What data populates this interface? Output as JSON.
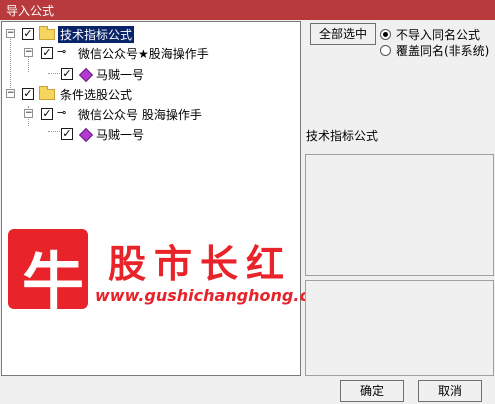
{
  "window": {
    "title": "导入公式"
  },
  "tree": {
    "nodes": [
      {
        "label": "技术指标公式"
      },
      {
        "label": "微信公众号★股海操作手"
      },
      {
        "label": "马贼一号"
      },
      {
        "label": "条件选股公式"
      },
      {
        "label": "微信公众号 股海操作手"
      },
      {
        "label": "马贼一号"
      }
    ]
  },
  "right": {
    "select_all_label": "全部选中",
    "option_skip_label": "不导入同名公式",
    "option_overwrite_label": "覆盖同名(非系统)",
    "section_title": "技术指标公式"
  },
  "watermark": {
    "logo_char": "牛",
    "name": "股市长红",
    "url": "www.gushichanghong.com"
  },
  "footer": {
    "ok_label": "确定",
    "cancel_label": "取消"
  }
}
